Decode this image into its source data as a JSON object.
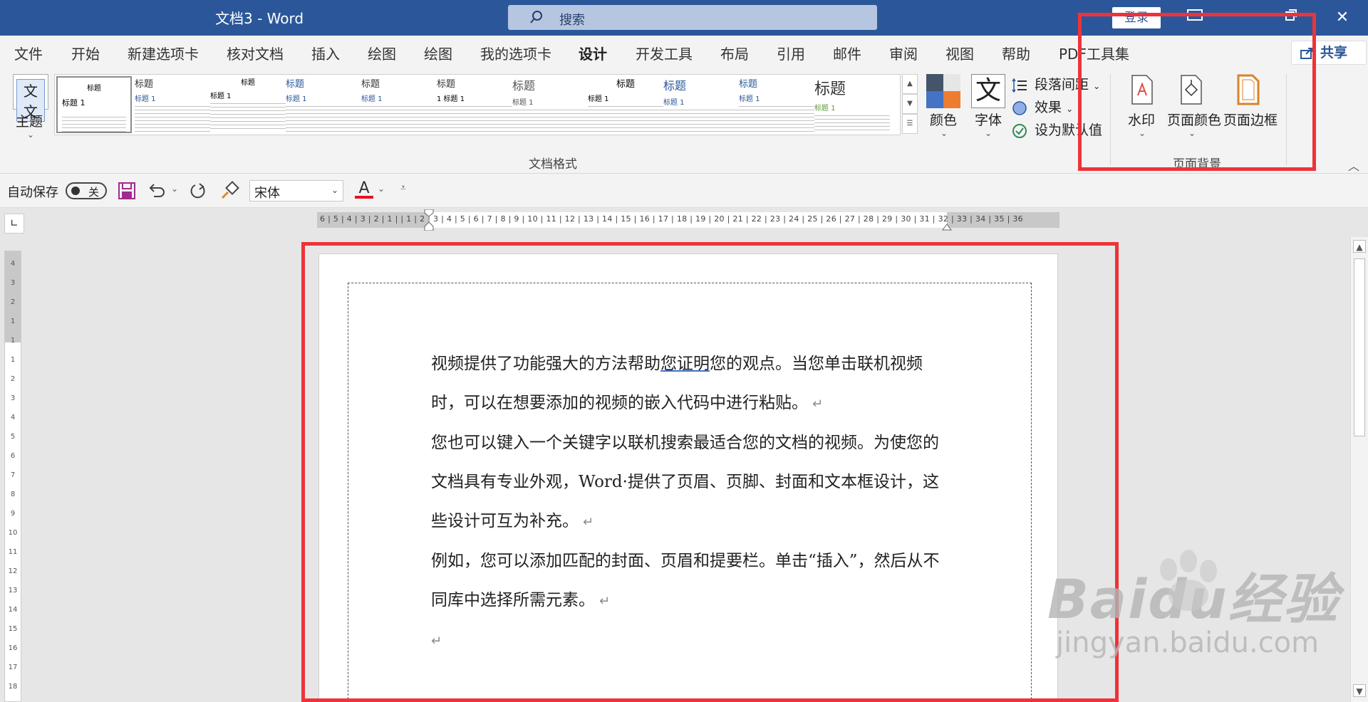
{
  "app": {
    "title": "文档3  -  Word"
  },
  "search": {
    "placeholder": "搜索"
  },
  "titlebar": {
    "login": "登录",
    "close_glyph": "✕"
  },
  "tabs": [
    "文件",
    "开始",
    "新建选项卡",
    "核对文档",
    "插入",
    "绘图",
    "绘图",
    "我的选项卡",
    "设计",
    "开发工具",
    "布局",
    "引用",
    "邮件",
    "审阅",
    "视图",
    "帮助",
    "PDF工具集"
  ],
  "active_tab": "设计",
  "share": {
    "label": "共享"
  },
  "ribbon": {
    "theme_label": "主题",
    "theme_icon_text": "文文",
    "gallery_styles": [
      {
        "title": "标题",
        "heading": "标题 1"
      },
      {
        "title": "标题",
        "heading": "标题 1"
      },
      {
        "title": "标题",
        "heading": "标题 1"
      },
      {
        "title": "标题",
        "heading": "标题 1"
      },
      {
        "title": "标题",
        "heading": "标题 1"
      },
      {
        "title": "标题",
        "heading": "1  标题 1"
      },
      {
        "title": "标题",
        "heading": "标题 1"
      },
      {
        "title": "标题",
        "heading": "标题 1"
      },
      {
        "title": "标题",
        "heading": "标题 1"
      },
      {
        "title": "标题",
        "heading": "标题 1"
      },
      {
        "title": "标题",
        "heading": "标题 1"
      }
    ],
    "colors_label": "颜色",
    "fonts_label": "字体",
    "fonts_icon": "文",
    "paragraph_spacing": "段落间距",
    "effects": "效果",
    "set_default": "设为默认值",
    "doc_format_group": "文档格式",
    "watermark": "水印",
    "page_color": "页面颜色",
    "page_border": "页面边框",
    "page_background_group": "页面背景"
  },
  "qat": {
    "autosave_label": "自动保存",
    "autosave_state": "关",
    "font_name": "宋体",
    "font_color_letter": "A"
  },
  "ruler": {
    "horizontal": "6 | 5 | 4 | 3 | 2 | 1 |  | 1 | 2 | 3 | 4 | 5 | 6 | 7 | 8 | 9 | 10 | 11 | 12 | 13 | 14 | 15 | 16 | 17 | 18 | 19 | 20 | 21 | 22 | 23 | 24 | 25 | 26 | 27 | 28 | 29 | 30 | 31 | 32 | 33 | 34 | 35 | 36",
    "vertical": "4 3 2 1 1 1 2 3 4 5 6 7 8 9 10 11 12 13 14 15 16 17 18"
  },
  "document": {
    "p1_a": "视频提供了功能强大的方法帮助",
    "p1_ul": "您证明",
    "p1_b": "您的观点。当您单击联机视频时，可以在想要添加的视频的嵌入代码中进行粘贴。",
    "p2": "您也可以键入一个关键字以联机搜索最适合您的文档的视频。为使您的文档具有专业外观，Word·提供了页眉、页脚、封面和文本框设计，这些设计可互为补充。",
    "p3": "例如，您可以添加匹配的封面、页眉和提要栏。单击“插入”，然后从不同库中选择所需元素。",
    "para_mark": "↵"
  },
  "watermark": {
    "brand": "Baidu经验",
    "url": "jingyan.baidu.com"
  },
  "colors": {
    "title_bar": "#2b579a",
    "highlight": "#ee3338",
    "font_color_bar": "#e81123"
  }
}
